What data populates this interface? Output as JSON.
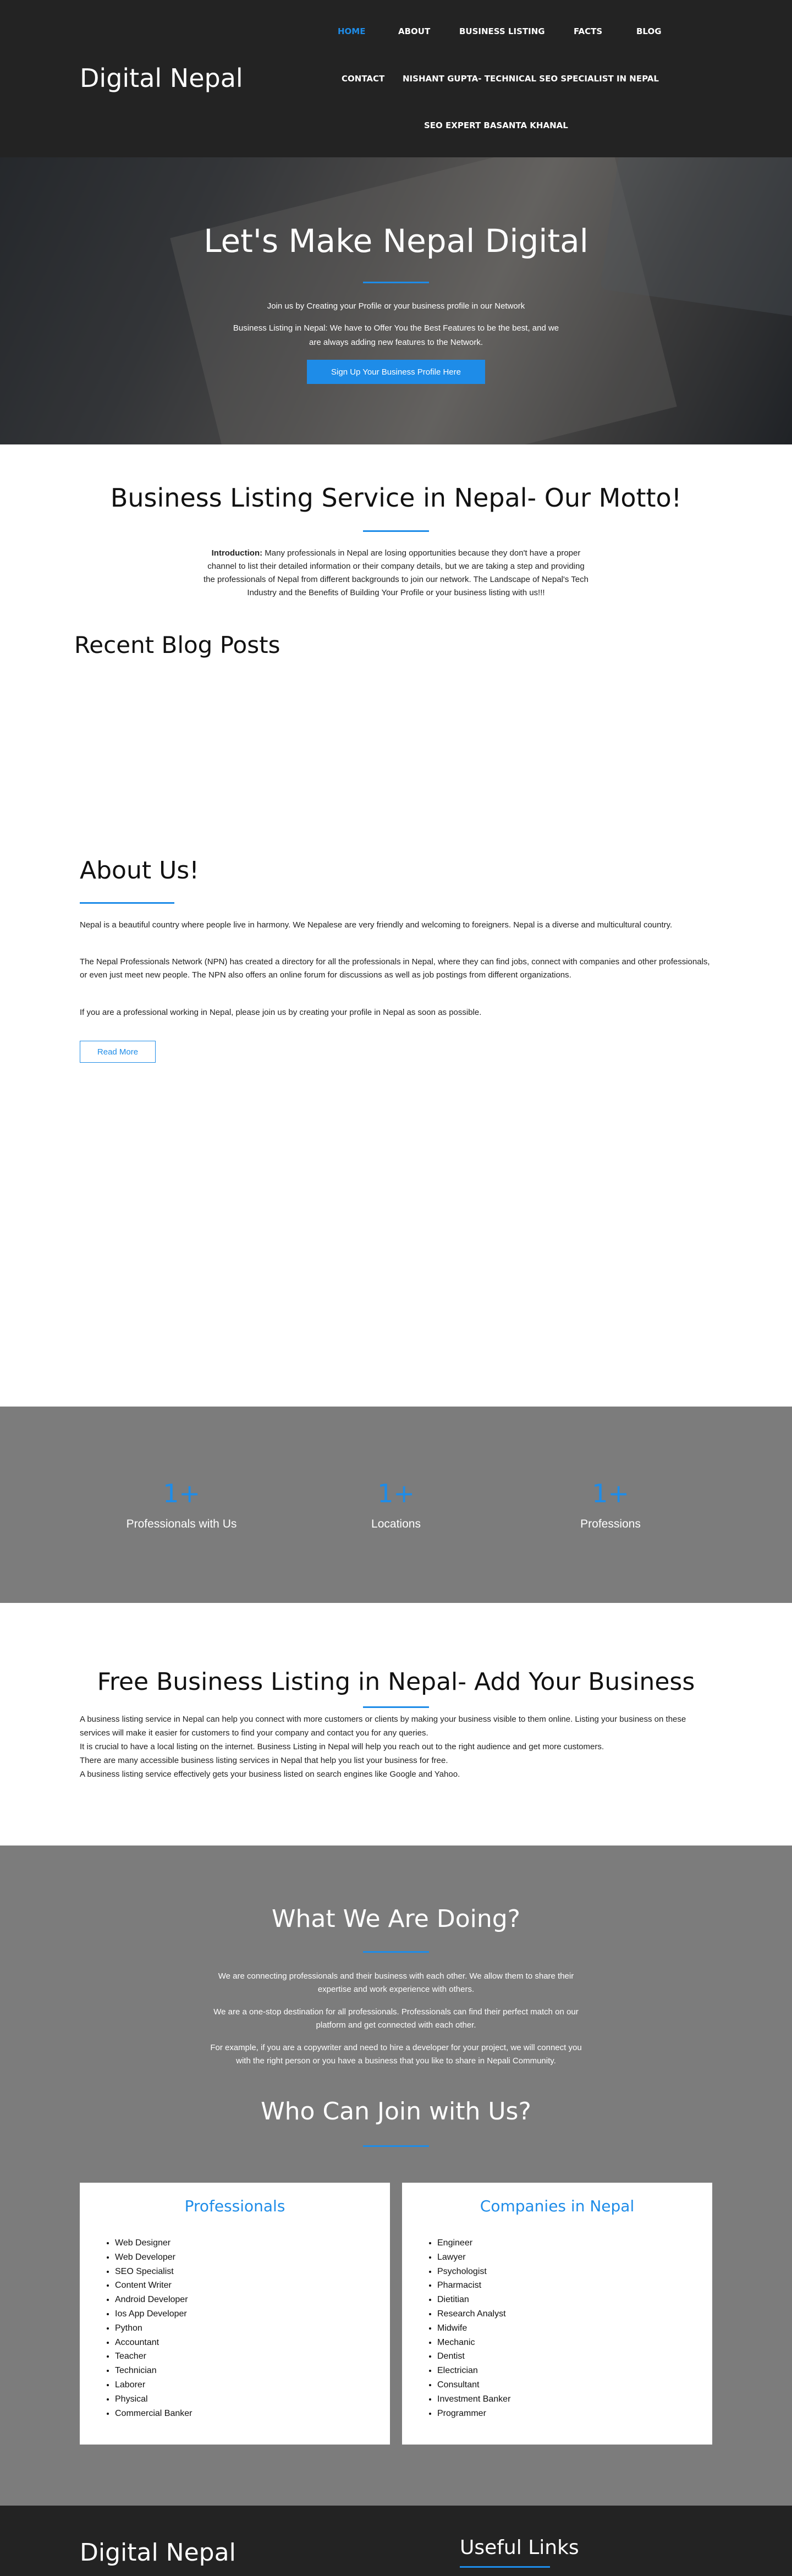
{
  "header": {
    "logo": "Digital Nepal",
    "nav": [
      {
        "label": "HOME",
        "active": true
      },
      {
        "label": "ABOUT"
      },
      {
        "label": "BUSINESS LISTING"
      },
      {
        "label": "FACTS"
      },
      {
        "label": "BLOG"
      },
      {
        "label": "CONTACT"
      },
      {
        "label": "NISHANT GUPTA- TECHNICAL SEO SPECIALIST IN NEPAL"
      },
      {
        "label": "SEO EXPERT BASANTA KHANAL"
      }
    ]
  },
  "hero": {
    "title": "Let's Make Nepal Digital",
    "line1": "Join us by Creating your Profile or your business profile in our Network",
    "line2": "Business Listing in Nepal: We have to Offer You the Best Features to be the best, and we",
    "line3": "are always adding new features to the Network.",
    "cta": "Sign Up Your Business Profile Here"
  },
  "motto": {
    "title": "Business Listing Service in Nepal- Our Motto!",
    "intro_label": "Introduction:",
    "intro_text": " Many professionals in Nepal are losing opportunities because they don't have a proper channel to list their detailed information or their company details, but we are taking a step and providing the professionals of Nepal from different backgrounds to join our network. The Landscape of Nepal's Tech Industry and the Benefits of Building Your Profile or your business listing with us!!!"
  },
  "blog": {
    "title": "Recent Blog Posts"
  },
  "about": {
    "title": "About Us!",
    "p1": "Nepal is a beautiful country where people live in harmony. We Nepalese are very friendly and welcoming to foreigners. Nepal is a diverse and multicultural country.",
    "p2": "The Nepal Professionals Network (NPN) has created a directory for all the professionals in Nepal, where they can find jobs, connect with companies and other professionals, or even just meet new people. The NPN also offers an online forum for discussions as well as job postings from different organizations.",
    "p3": "If you are a professional working in Nepal, please join us by creating your profile in Nepal as soon as possible.",
    "read_more": "Read More"
  },
  "stats": [
    {
      "value": "1+",
      "label": "Professionals with Us"
    },
    {
      "value": "1+",
      "label": "Locations"
    },
    {
      "value": "1+",
      "label": "Professions"
    }
  ],
  "free_listing": {
    "title": "Free Business Listing in Nepal- Add Your Business",
    "lines": [
      "A business listing service in Nepal can help you connect with more customers or clients by making your business visible to them online. Listing your business on these services will make it easier for customers to find your company and contact you for any queries.",
      "It is crucial to have a local listing on the internet. Business Listing in Nepal will help you reach out to the right audience and get more customers.",
      "There are many accessible business listing services in Nepal that help you list your business for free.",
      "A business listing service effectively gets your business listed on search engines like Google and Yahoo."
    ]
  },
  "doing": {
    "title": "What We Are Doing?",
    "p1": "We are connecting professionals and their business with each other. We allow them to share their expertise and work experience with others.",
    "p2": "We are a one-stop destination for all professionals. Professionals can find their perfect match on our platform and get connected with each other.",
    "p3": "For example, if you are a copywriter and need to hire a developer for your project, we will connect you with the right person or you have a business that you like to share in Nepali Community."
  },
  "join": {
    "title": "Who Can Join with Us?",
    "professionals": {
      "title": "Professionals",
      "items": [
        "Web Designer",
        "Web Developer",
        "SEO Specialist",
        "Content Writer",
        "Android Developer",
        "Ios App Developer",
        "Python",
        "Accountant",
        "Teacher",
        "Technician",
        "Laborer",
        "Physical",
        "Commercial Banker"
      ]
    },
    "companies": {
      "title": "Companies in Nepal",
      "items": [
        "Engineer",
        "Lawyer",
        "Psychologist",
        "Pharmacist",
        "Dietitian",
        "Research Analyst",
        "Midwife",
        "Mechanic",
        "Dentist",
        "Electrician",
        "Consultant",
        "Investment Banker",
        "Programmer"
      ]
    }
  },
  "footer": {
    "logo": "Digital Nepal",
    "useful_links": "Useful Links"
  },
  "colors": {
    "accent": "#1e8ce8",
    "dark": "#232323",
    "gray_section": "#7c7c7c"
  }
}
